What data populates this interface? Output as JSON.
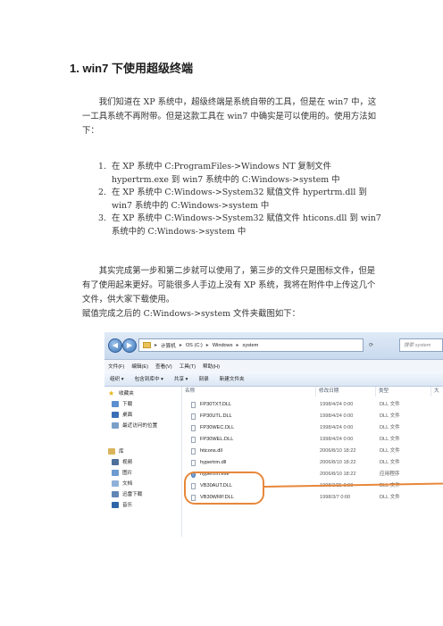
{
  "heading": "1. win7 下使用超级终端",
  "intro": "我们知道在 XP 系统中，超级终端是系统自带的工具，但是在 win7 中，这一工具系统不再附带。但是这款工具在 win7 中确实是可以使用的。使用方法如下：",
  "steps": [
    {
      "num": "1.",
      "text": "在 XP 系统中 C:ProgramFiles->Windows NT 复制文件 hypertrm.exe 到 win7 系统中的 C:Windows->system 中"
    },
    {
      "num": "2.",
      "text": "在 XP 系统中 C:Windows->System32 赋值文件 hypertrm.dll 到 win7 系统中的 C:Windows->system 中"
    },
    {
      "num": "3.",
      "text": "在 XP 系统中 C:Windows->System32 赋值文件 hticons.dll 到 win7 系统中的 C:Windows->system 中"
    }
  ],
  "closing1": "其实完成第一步和第二步就可以使用了，第三步的文件只是图标文件，但是有了使用起来更好。可能很多人手边上没有 XP 系统，我将在附件中上传这几个文件，供大家下载使用。",
  "closing2": "赋值完成之后的 C:Windows->system 文件夹截图如下：",
  "screenshot": {
    "address": [
      "计算机",
      "OS (C:)",
      "Windows",
      "system"
    ],
    "search_placeholder": "搜索 system",
    "menu": [
      "文件(F)",
      "编辑(E)",
      "查看(V)",
      "工具(T)",
      "帮助(H)"
    ],
    "toolbar": [
      "组织 ▾",
      "包含到库中 ▾",
      "共享 ▾",
      "刻录",
      "新建文件夹"
    ],
    "sidebar": {
      "favorites": "收藏夹",
      "download": "下载",
      "desktop": "桌面",
      "recent": "最近访问的位置",
      "library": "库",
      "video": "视频",
      "pictures": "图片",
      "documents": "文档",
      "thunder": "迅雷下载",
      "music": "音乐"
    },
    "columns": {
      "name": "名称",
      "date": "修改日期",
      "type": "类型",
      "size": "大"
    },
    "files": [
      {
        "name": "FP30TXT.DLL",
        "date": "1998/4/24 0:00",
        "type": "DLL 文件",
        "kind": "dll"
      },
      {
        "name": "FP30UTL.DLL",
        "date": "1998/4/24 0:00",
        "type": "DLL 文件",
        "kind": "dll"
      },
      {
        "name": "FP30WEC.DLL",
        "date": "1998/4/24 0:00",
        "type": "DLL 文件",
        "kind": "dll"
      },
      {
        "name": "FP30WEL.DLL",
        "date": "1998/4/24 0:00",
        "type": "DLL 文件",
        "kind": "dll"
      },
      {
        "name": "hticons.dll",
        "date": "2006/8/10 18:22",
        "type": "DLL 文件",
        "kind": "dll"
      },
      {
        "name": "hypertrm.dll",
        "date": "2006/8/10 18:22",
        "type": "DLL 文件",
        "kind": "dll"
      },
      {
        "name": "hypertrm.exe",
        "date": "2006/8/10 18:22",
        "type": "应用程序",
        "kind": "exe"
      },
      {
        "name": "VB30AUT.DLL",
        "date": "1998/3/25 0:00",
        "type": "DLL 文件",
        "kind": "dll"
      },
      {
        "name": "VB30WRP.DLL",
        "date": "1998/3/7 0:00",
        "type": "DLL 文件",
        "kind": "dll"
      }
    ],
    "colors": {
      "highlight": "#e8873a",
      "accent": "#3d73b5"
    }
  }
}
